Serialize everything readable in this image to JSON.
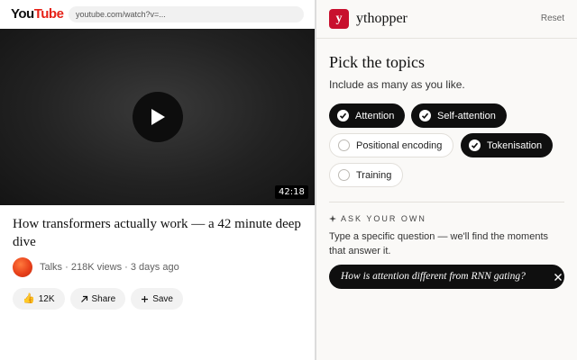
{
  "youtube": {
    "logo_you": "You",
    "logo_tube": "Tube",
    "url": "youtube.com/watch?v=...",
    "duration": "42:18",
    "title": "How transformers actually work — a 42 minute deep dive",
    "meta": "Talks · 218K views · 3 days ago",
    "like_count": "12K",
    "share_label": "Share",
    "save_label": "Save",
    "icons": {
      "like": "thumbs-up-icon",
      "share": "share-arrow-icon",
      "save": "plus-icon",
      "play": "play-icon"
    }
  },
  "ythopper": {
    "logo_letter": "y",
    "name": "ythopper",
    "reset_label": "Reset",
    "heading": "Pick the topics",
    "subheading": "Include as many as you like.",
    "topics": [
      {
        "label": "Attention",
        "selected": true
      },
      {
        "label": "Self-attention",
        "selected": true
      },
      {
        "label": "Positional encoding",
        "selected": false
      },
      {
        "label": "Tokenisation",
        "selected": true
      },
      {
        "label": "Training",
        "selected": false
      }
    ],
    "ask_label": "ASK YOUR OWN",
    "ask_description": "Type a specific question — we'll find the moments that answer it.",
    "ask_value": "How is attention different from RNN gating?",
    "colors": {
      "brand": "#c8102e",
      "chip_active": "#0f0f0f",
      "panel_bg": "#faf9f7"
    }
  }
}
